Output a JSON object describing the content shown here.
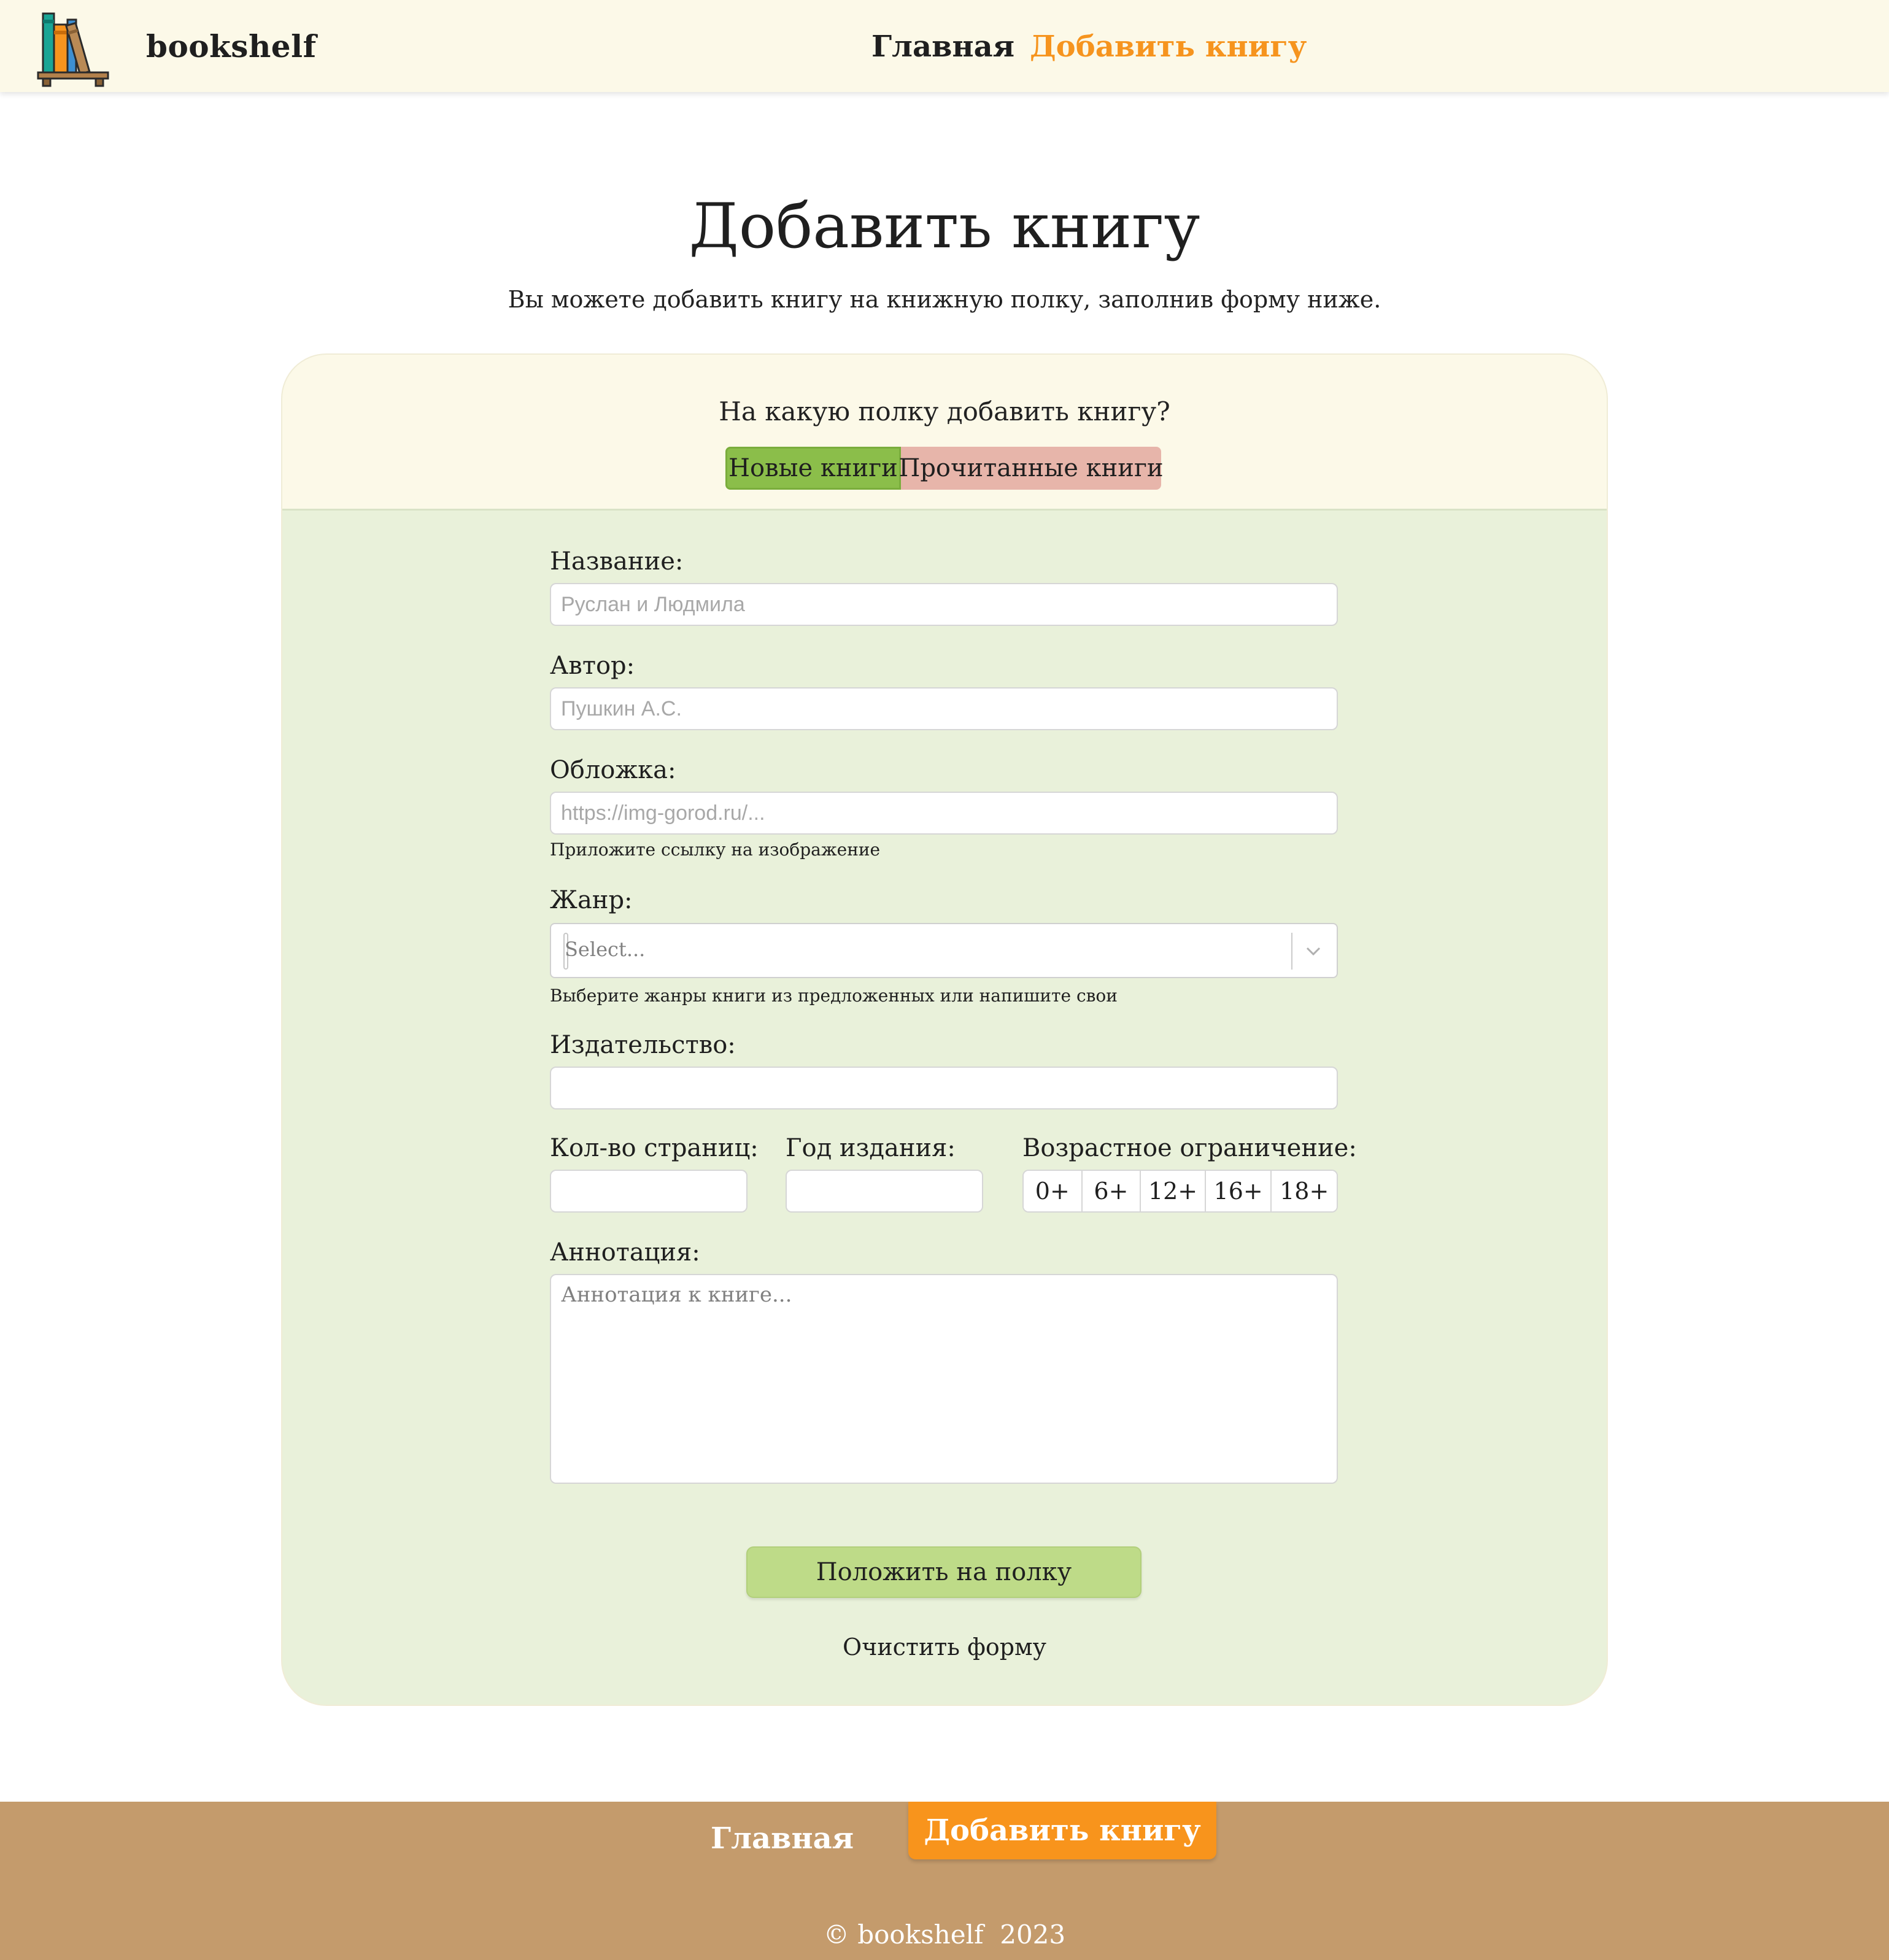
{
  "header": {
    "brand": "bookshelf",
    "nav": {
      "home": "Главная",
      "add_book": "Добавить книгу"
    },
    "logo_icon": "bookshelf-logo-icon"
  },
  "page": {
    "title": "Добавить книгу",
    "subtitle": "Вы можете добавить книгу на книжную полку, заполнив форму ниже."
  },
  "shelf": {
    "question": "На какую полку добавить книгу?",
    "options": [
      "Новые книги",
      "Прочитанные книги"
    ],
    "selected": "Новые книги"
  },
  "form": {
    "title": {
      "label": "Название:",
      "placeholder": "Руслан и Людмила",
      "value": ""
    },
    "author": {
      "label": "Автор:",
      "placeholder": "Пушкин А.С.",
      "value": ""
    },
    "cover": {
      "label": "Обложка:",
      "placeholder": "https://img-gorod.ru/...",
      "hint": "Приложите ссылку на изображение"
    },
    "genre": {
      "label": "Жанр:",
      "placeholder": "Select...",
      "hint": "Выберите жанры книги из предложенных или напишите свои"
    },
    "publisher": {
      "label": "Издательство:"
    },
    "pages": {
      "label": "Кол-во страниц:"
    },
    "year": {
      "label": "Год издания:"
    },
    "age": {
      "label": "Возрастное ограничение:",
      "options": [
        "0+",
        "6+",
        "12+",
        "16+",
        "18+"
      ]
    },
    "annotation": {
      "label": "Аннотация:",
      "placeholder": "Аннотация к книге..."
    },
    "submit_label": "Положить на полку",
    "clear_label": "Очистить форму"
  },
  "footer": {
    "home": "Главная",
    "add_book": "Добавить книгу",
    "copyright": "© bookshelf  2023"
  },
  "colors": {
    "accent": "#f6941e",
    "header_bg": "#fcf9e8",
    "form_bg": "#e9f1da",
    "new_books": "#8bbe4a",
    "read_books": "#e7b5aa",
    "submit": "#bedb88",
    "footer_bg": "#c49b6c"
  }
}
